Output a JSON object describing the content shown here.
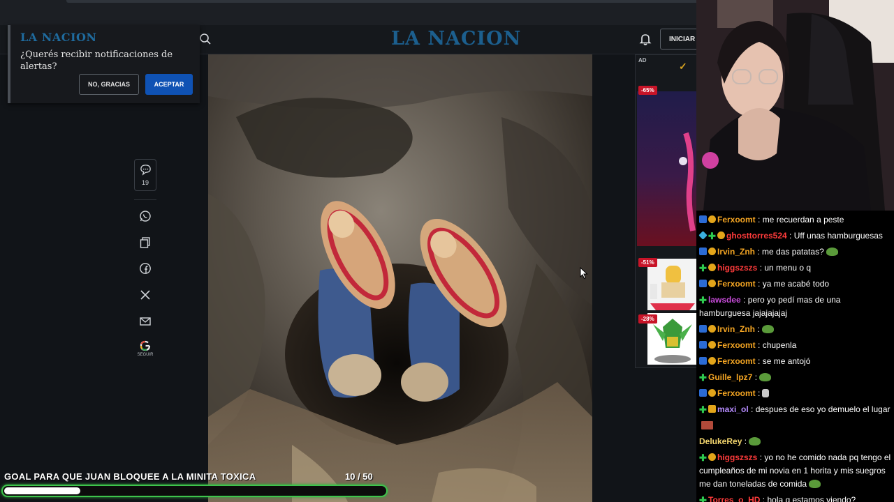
{
  "site": {
    "logo": "LA NACION",
    "login_label": "INICIAR"
  },
  "notification": {
    "logo": "LA NACION",
    "question": "¿Querés recibir notificaciones de alertas?",
    "decline_label": "NO, GRACIAS",
    "accept_label": "ACEPTAR"
  },
  "share_rail": {
    "comments_count": "19",
    "follow_label": "SEGUIR"
  },
  "ad": {
    "label": "AD",
    "brand": "✓",
    "badges": [
      "-65%",
      "-51%",
      "-28%"
    ]
  },
  "goal": {
    "title": "GOAL PARA QUE JUAN BLOQUEE A LA MINITA TOXICA",
    "count_text": "10 / 50",
    "progress": 0.2
  },
  "chat": {
    "messages": [
      {
        "badges": [
          "sub",
          "gold"
        ],
        "user": "Ferxoomt",
        "color": "#f5a623",
        "text": ": me recuerdan a peste",
        "emote": null
      },
      {
        "badges": [
          "diamond",
          "gift",
          "gold"
        ],
        "user": "ghosttorres524",
        "color": "#ff3b3b",
        "text": ": Uff unas hamburguesas",
        "emote": null
      },
      {
        "badges": [
          "sub",
          "gold"
        ],
        "user": "Irvin_Znh",
        "color": "#f5a623",
        "text": ": me das patatas?",
        "emote": "frog"
      },
      {
        "badges": [
          "gift",
          "gold"
        ],
        "user": "higgszszs",
        "color": "#ff3b3b",
        "text": ": un menu o q",
        "emote": null
      },
      {
        "badges": [
          "sub",
          "gold"
        ],
        "user": "Ferxoomt",
        "color": "#f5a623",
        "text": ": ya me acabé todo",
        "emote": null
      },
      {
        "badges": [
          "gift"
        ],
        "user": "lawsdee",
        "color": "#c64bd8",
        "text": ": pero yo pedí mas de una hamburguesa jajajajajaj",
        "emote": null
      },
      {
        "badges": [
          "sub",
          "gold"
        ],
        "user": "Irvin_Znh",
        "color": "#f5a623",
        "text": ":",
        "emote": "frog"
      },
      {
        "badges": [
          "sub",
          "gold"
        ],
        "user": "Ferxoomt",
        "color": "#f5a623",
        "text": ": chupenla",
        "emote": null
      },
      {
        "badges": [
          "sub",
          "gold"
        ],
        "user": "Ferxoomt",
        "color": "#f5a623",
        "text": ": se me antojó",
        "emote": null
      },
      {
        "badges": [
          "gift"
        ],
        "user": "Guille_lpz7",
        "color": "#f5a623",
        "text": ":",
        "emote": "frog"
      },
      {
        "badges": [
          "sub",
          "gold"
        ],
        "user": "Ferxoomt",
        "color": "#f5a623",
        "text": ":",
        "emote": "runner"
      },
      {
        "badges": [
          "gift",
          "chest"
        ],
        "user": "maxi_ol",
        "color": "#b68cff",
        "text": ": despues de eso yo demuelo el lugar",
        "emote": "brick"
      },
      {
        "badges": [],
        "user": "DelukeRey",
        "color": "#f5d76e",
        "text": ":",
        "emote": "frog"
      },
      {
        "badges": [
          "gift",
          "gold"
        ],
        "user": "higgszszs",
        "color": "#ff3b3b",
        "text": ": yo no he comido nada pq tengo el cumpleaños de mi novia en 1 horita y mis suegros me dan toneladas de comida",
        "emote": "frog"
      },
      {
        "badges": [
          "gift"
        ],
        "user": "Torres_o_HD",
        "color": "#ff3b3b",
        "text": ": hola q estamos viendo?",
        "emote": null
      }
    ]
  }
}
